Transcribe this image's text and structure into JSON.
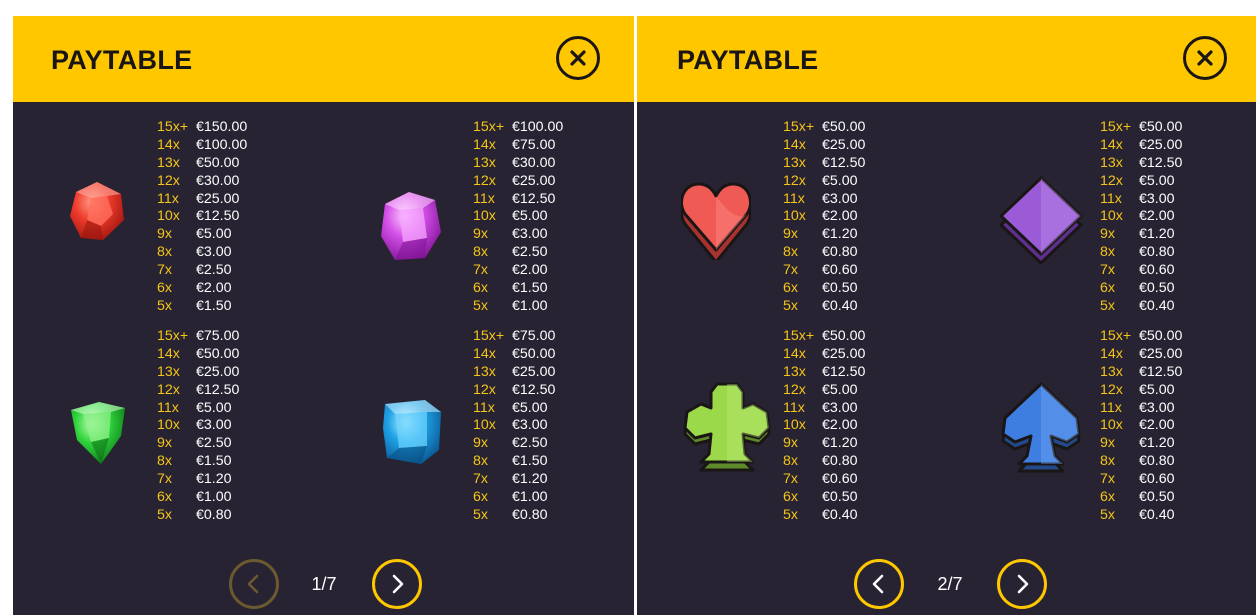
{
  "colors": {
    "header_bg": "#ffc700",
    "panel_bg": "#272333",
    "multiplier_text": "#f5c518",
    "value_text": "#ffffff",
    "button_ring": "#ffc700"
  },
  "panels": [
    {
      "title": "PAYTABLE",
      "close_icon": "close-x-icon",
      "page_indicator": "1/7",
      "prev_icon": "chevron-left-icon",
      "next_icon": "chevron-right-icon",
      "symbols": [
        {
          "icon": "red-gem-icon",
          "color": "#e8362c",
          "rows": [
            [
              "15x+",
              "€150.00"
            ],
            [
              "14x",
              "€100.00"
            ],
            [
              "13x",
              "€50.00"
            ],
            [
              "12x",
              "€30.00"
            ],
            [
              "11x",
              "€25.00"
            ],
            [
              "10x",
              "€12.50"
            ],
            [
              "9x",
              "€5.00"
            ],
            [
              "8x",
              "€3.00"
            ],
            [
              "7x",
              "€2.50"
            ],
            [
              "6x",
              "€2.00"
            ],
            [
              "5x",
              "€1.50"
            ]
          ]
        },
        {
          "icon": "purple-gem-icon",
          "color": "#cf4fe0",
          "rows": [
            [
              "15x+",
              "€100.00"
            ],
            [
              "14x",
              "€75.00"
            ],
            [
              "13x",
              "€30.00"
            ],
            [
              "12x",
              "€25.00"
            ],
            [
              "11x",
              "€12.50"
            ],
            [
              "10x",
              "€5.00"
            ],
            [
              "9x",
              "€3.00"
            ],
            [
              "8x",
              "€2.50"
            ],
            [
              "7x",
              "€2.00"
            ],
            [
              "6x",
              "€1.50"
            ],
            [
              "5x",
              "€1.00"
            ]
          ]
        },
        {
          "icon": "green-gem-icon",
          "color": "#2fd43c",
          "rows": [
            [
              "15x+",
              "€75.00"
            ],
            [
              "14x",
              "€50.00"
            ],
            [
              "13x",
              "€25.00"
            ],
            [
              "12x",
              "€12.50"
            ],
            [
              "11x",
              "€5.00"
            ],
            [
              "10x",
              "€3.00"
            ],
            [
              "9x",
              "€2.50"
            ],
            [
              "8x",
              "€1.50"
            ],
            [
              "7x",
              "€1.20"
            ],
            [
              "6x",
              "€1.00"
            ],
            [
              "5x",
              "€0.80"
            ]
          ]
        },
        {
          "icon": "blue-gem-icon",
          "color": "#1fa3e6",
          "rows": [
            [
              "15x+",
              "€75.00"
            ],
            [
              "14x",
              "€50.00"
            ],
            [
              "13x",
              "€25.00"
            ],
            [
              "12x",
              "€12.50"
            ],
            [
              "11x",
              "€5.00"
            ],
            [
              "10x",
              "€3.00"
            ],
            [
              "9x",
              "€2.50"
            ],
            [
              "8x",
              "€1.50"
            ],
            [
              "7x",
              "€1.20"
            ],
            [
              "6x",
              "€1.00"
            ],
            [
              "5x",
              "€0.80"
            ]
          ]
        }
      ]
    },
    {
      "title": "PAYTABLE",
      "close_icon": "close-x-icon",
      "page_indicator": "2/7",
      "prev_icon": "chevron-left-icon",
      "next_icon": "chevron-right-icon",
      "symbols": [
        {
          "icon": "heart-suit-icon",
          "color": "#f05a55",
          "rows": [
            [
              "15x+",
              "€50.00"
            ],
            [
              "14x",
              "€25.00"
            ],
            [
              "13x",
              "€12.50"
            ],
            [
              "12x",
              "€5.00"
            ],
            [
              "11x",
              "€3.00"
            ],
            [
              "10x",
              "€2.00"
            ],
            [
              "9x",
              "€1.20"
            ],
            [
              "8x",
              "€0.80"
            ],
            [
              "7x",
              "€0.60"
            ],
            [
              "6x",
              "€0.50"
            ],
            [
              "5x",
              "€0.40"
            ]
          ]
        },
        {
          "icon": "diamond-suit-icon",
          "color": "#9c5bd6",
          "rows": [
            [
              "15x+",
              "€50.00"
            ],
            [
              "14x",
              "€25.00"
            ],
            [
              "13x",
              "€12.50"
            ],
            [
              "12x",
              "€5.00"
            ],
            [
              "11x",
              "€3.00"
            ],
            [
              "10x",
              "€2.00"
            ],
            [
              "9x",
              "€1.20"
            ],
            [
              "8x",
              "€0.80"
            ],
            [
              "7x",
              "€0.60"
            ],
            [
              "6x",
              "€0.50"
            ],
            [
              "5x",
              "€0.40"
            ]
          ]
        },
        {
          "icon": "club-suit-icon",
          "color": "#9bd84a",
          "rows": [
            [
              "15x+",
              "€50.00"
            ],
            [
              "14x",
              "€25.00"
            ],
            [
              "13x",
              "€12.50"
            ],
            [
              "12x",
              "€5.00"
            ],
            [
              "11x",
              "€3.00"
            ],
            [
              "10x",
              "€2.00"
            ],
            [
              "9x",
              "€1.20"
            ],
            [
              "8x",
              "€0.80"
            ],
            [
              "7x",
              "€0.60"
            ],
            [
              "6x",
              "€0.50"
            ],
            [
              "5x",
              "€0.40"
            ]
          ]
        },
        {
          "icon": "spade-suit-icon",
          "color": "#3d7ee0",
          "rows": [
            [
              "15x+",
              "€50.00"
            ],
            [
              "14x",
              "€25.00"
            ],
            [
              "13x",
              "€12.50"
            ],
            [
              "12x",
              "€5.00"
            ],
            [
              "11x",
              "€3.00"
            ],
            [
              "10x",
              "€2.00"
            ],
            [
              "9x",
              "€1.20"
            ],
            [
              "8x",
              "€0.80"
            ],
            [
              "7x",
              "€0.60"
            ],
            [
              "6x",
              "€0.50"
            ],
            [
              "5x",
              "€0.40"
            ]
          ]
        }
      ]
    }
  ]
}
